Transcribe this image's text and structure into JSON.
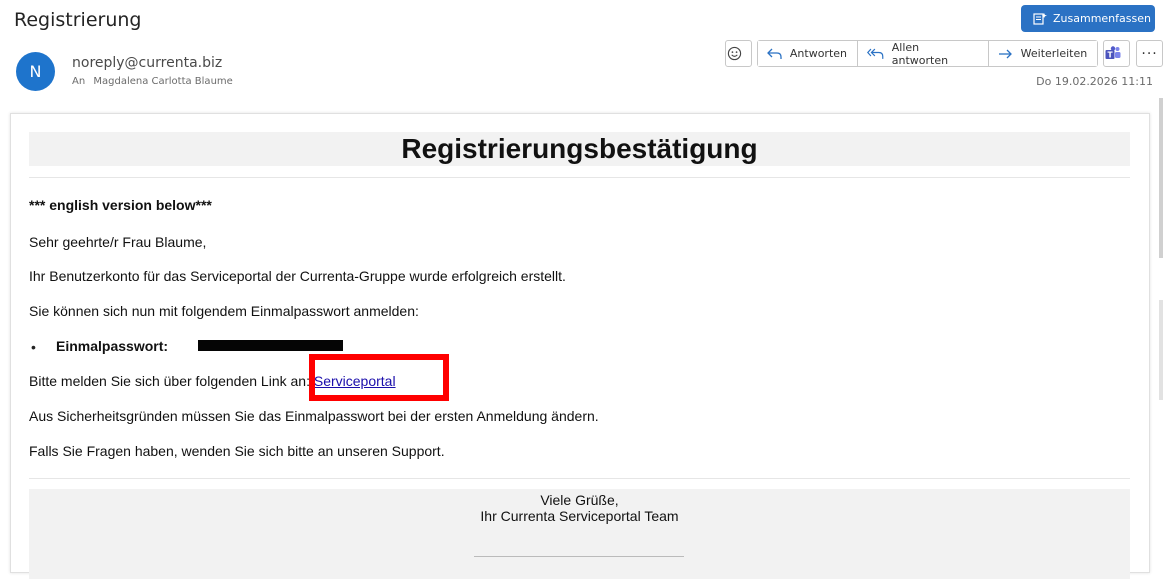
{
  "header": {
    "subject": "Registrierung",
    "summarize_label": "Zusammenfassen",
    "avatar_initial": "N",
    "sender": "noreply@currenta.biz",
    "to_label": "An",
    "recipient": "Magdalena Carlotta Blaume",
    "date": "Do 19.02.2026 11:11"
  },
  "toolbar": {
    "reply": "Antworten",
    "reply_all": "Allen antworten",
    "forward": "Weiterleiten",
    "more": "···"
  },
  "email": {
    "heading": "Registrierungsbestätigung",
    "english_note": "*** english version below***",
    "greeting": "Sehr geehrte/r Frau Blaume,",
    "line1": "Ihr Benutzerkonto für das Serviceportal der Currenta-Gruppe wurde erfolgreich erstellt.",
    "line2": "Sie können sich nun mit folgendem Einmalpasswort anmelden:",
    "password_label": "Einmalpasswort:",
    "login_prefix": "Bitte melden Sie sich über folgenden Link an:",
    "link_text": "Serviceportal",
    "line4": "Aus Sicherheitsgründen müssen Sie das Einmalpasswort bei der ersten Anmeldung ändern.",
    "line5": "Falls Sie Fragen haben, wenden Sie sich bitte an unseren Support.",
    "closing1": "Viele Grüße,",
    "closing2": "Ihr Currenta Serviceportal Team"
  },
  "colors": {
    "accent": "#2b72c4",
    "avatar": "#1e74cc",
    "highlight": "#ff0000",
    "link": "#1a0dab"
  }
}
